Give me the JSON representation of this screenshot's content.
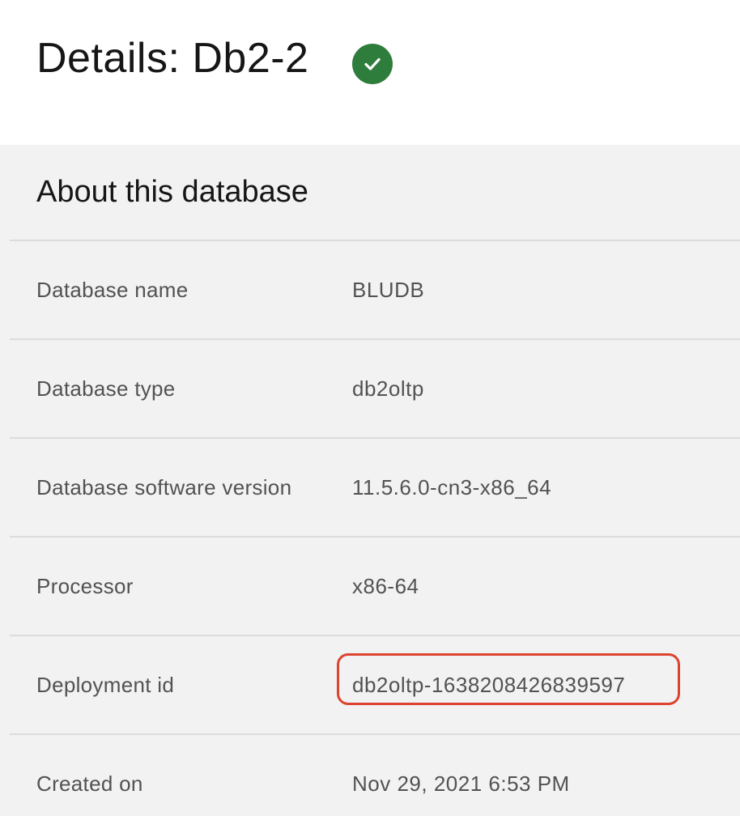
{
  "header": {
    "title": "Details: Db2-2",
    "status_icon": "checkmark-circle-icon",
    "status_color": "#2f7d3c"
  },
  "about": {
    "title": "About this database",
    "rows": [
      {
        "label": "Database name",
        "value": "BLUDB"
      },
      {
        "label": "Database type",
        "value": "db2oltp"
      },
      {
        "label": "Database software version",
        "value": "11.5.6.0-cn3-x86_64"
      },
      {
        "label": "Processor",
        "value": "x86-64"
      },
      {
        "label": "Deployment id",
        "value": "db2oltp-1638208426839597",
        "highlighted": true
      },
      {
        "label": "Created on",
        "value": "Nov 29, 2021 6:53 PM"
      }
    ]
  },
  "colors": {
    "panel_background": "#f2f2f2",
    "highlight_outline": "#dc4330"
  }
}
